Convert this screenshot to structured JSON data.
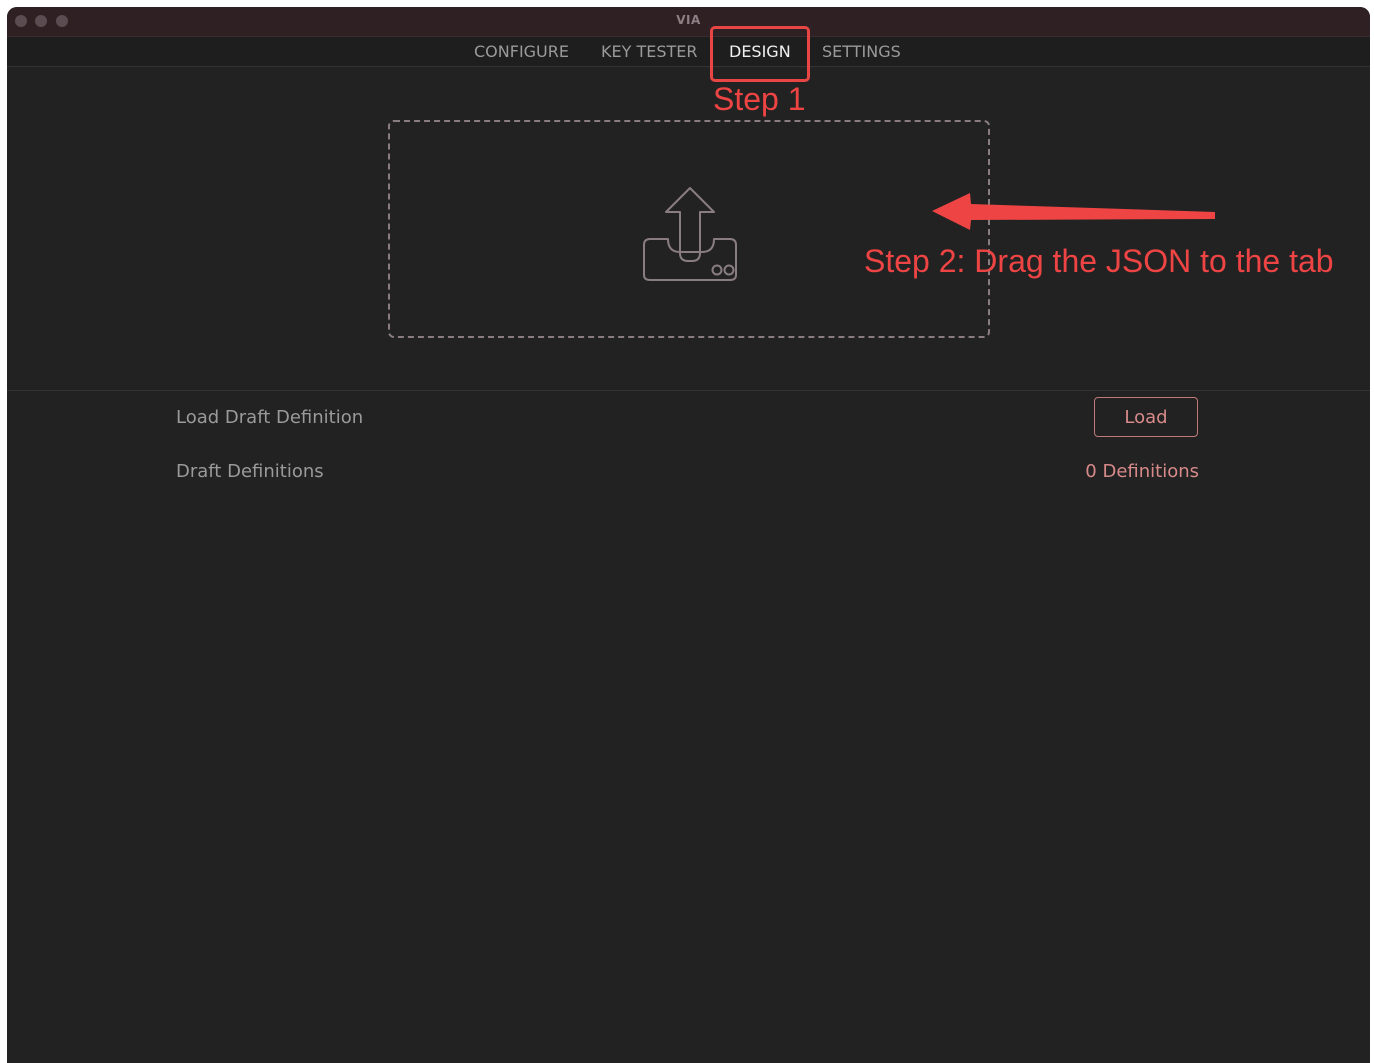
{
  "window": {
    "title": "VIA"
  },
  "nav": {
    "tabs": [
      {
        "label": "CONFIGURE",
        "active": false
      },
      {
        "label": "KEY TESTER",
        "active": false
      },
      {
        "label": "DESIGN",
        "active": true
      },
      {
        "label": "SETTINGS",
        "active": false
      }
    ]
  },
  "annotations": {
    "step1": "Step 1",
    "step2": "Step 2: Drag the JSON to the tab",
    "color": "#ee4444"
  },
  "dropzone": {
    "icon": "upload-icon"
  },
  "design": {
    "load_draft_label": "Load Draft Definition",
    "load_button_label": "Load",
    "draft_definitions_label": "Draft Definitions",
    "definitions_count": "0 Definitions"
  },
  "colors": {
    "background": "#222222",
    "accent": "#d88a8a",
    "text_muted": "#9a9a9a"
  }
}
